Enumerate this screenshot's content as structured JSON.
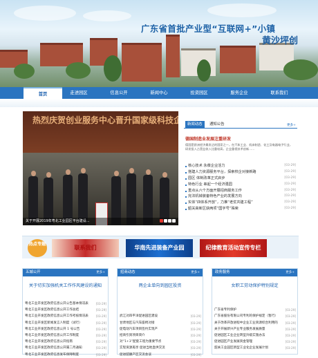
{
  "banner": {
    "title": "广东省首批产业型“互联网+”小镇",
    "subtitle": "黄沙坪创"
  },
  "nav": [
    "首页",
    "走进园区",
    "信息公开",
    "新闻中心",
    "投资园区",
    "服务企业",
    "联系我们"
  ],
  "slideshow": {
    "caption": "关于开展2019年粤北工业园区平台建设...",
    "banner_text": "热烈庆贺创业服务中心晋升国家级科技企业孵化器"
  },
  "news": {
    "tabs": [
      "新闻动态",
      "通知公告"
    ],
    "more": "更多+",
    "headline": "德国制造业发展注重研发",
    "summary": "德国是欧洲经济最发达的国家之一，在汽车工业、机床制造、化工及电器电子行业，研发投入占营业收入比重较高，企业重视技术创新......",
    "items": [
      {
        "t": "核心技术 永葆企业活力",
        "d": "[03-29]"
      },
      {
        "t": "搭建人力资源服务平台，探索校企对接新路",
        "d": "[03-29]"
      },
      {
        "t": "园区 体制改革正式启步",
        "d": "[03-29]"
      },
      {
        "t": "特色行业 串起一个经济强园",
        "d": "[03-29]"
      },
      {
        "t": "重点从六个方面开展招商服务工作",
        "d": "[03-29]"
      },
      {
        "t": "完法机械装备特色产业的发展方向",
        "d": "[03-29]"
      },
      {
        "t": "实体“四体系开放”，力推“老优共建工程”",
        "d": "[03-29]"
      },
      {
        "t": "韶关高新区获两项“国字号”殊荣",
        "d": "[03-29]"
      }
    ]
  },
  "hot": {
    "label": "热点专题",
    "items": [
      "联系我们",
      "华南先进装备产业园",
      "纪律教育活动宣传专栏"
    ]
  },
  "cols": [
    {
      "title": "五城公开",
      "more": "更多+",
      "headline": "关于切实加强机关工作作风建设的通知",
      "rows": [
        {
          "t": "粤北工业开发区政府信息公开公告基本情况表",
          "d": "[03-29]"
        },
        {
          "t": "粤北工业开发区政府信息公开工作总结",
          "d": "[03-29]"
        },
        {
          "t": "粤北工业开发区政府信息公开工作考核情况表",
          "d": "[03-29]"
        },
        {
          "t": "粤北工业开发区新闻发言人制度（试行）",
          "d": "[03-29]"
        },
        {
          "t": "粤北工业开发区政府信息公开 1 号公告",
          "d": "[03-29]"
        },
        {
          "t": "粤北工业开发区政府信息公开工作制度",
          "d": "[03-29]"
        },
        {
          "t": "粤北工业开发区政府信息公开指南",
          "d": "[03-29]"
        },
        {
          "t": "粤北工业开发区政府信息公开属二月通知",
          "d": "[03-29]"
        },
        {
          "t": "粤北工业开发区政府信息发布保障制度",
          "d": "[03-29]"
        }
      ]
    },
    {
      "title": "招商动态",
      "more": "更多+",
      "headline": "两企业单向到园区投资",
      "rows": [
        {
          "t": "",
          "d": ""
        },
        {
          "t": "",
          "d": ""
        },
        {
          "t": "武江对四平洋促进园区建设",
          "d": "[03-29]"
        },
        {
          "t": "甘肃地区与汽车座椅对接",
          "d": "[03-29]"
        },
        {
          "t": "促电动汽车项目签约实现产",
          "d": "[03-29]"
        },
        {
          "t": "招商引资项目简介",
          "d": "[03-29]"
        },
        {
          "t": "对“1+3”配套工程为重要节点",
          "d": "[03-29]"
        },
        {
          "t": "实现资源再享 促进当地直供交流",
          "d": "[03-29]"
        },
        {
          "t": "促进韶康产区交流会谈",
          "d": "[03-29]"
        }
      ]
    },
    {
      "title": "政务服务",
      "more": "更多+",
      "headline": "女职工劳动保护特别规定",
      "rows": [
        {
          "t": "",
          "d": ""
        },
        {
          "t": "广东省专利保护",
          "d": "[03-29]"
        },
        {
          "t": "广东省股份有限公司专利的保护规定（暂行）",
          "d": "[03-29]"
        },
        {
          "t": "关于改革开放进程中企业工业资源综合利用的通知",
          "d": "[03-29]"
        },
        {
          "t": "关于开展新兴产业专业服务发展质量",
          "d": "[03-29]"
        },
        {
          "t": "促进园区工业企业转型升级实施办法",
          "d": "[03-29]"
        },
        {
          "t": "促进园区产业发展资金管理",
          "d": "[03-29]"
        },
        {
          "t": "韶关工业园区新型工业化企业发展计划",
          "d": "[03-29]"
        },
        {
          "t": "",
          "d": ""
        }
      ]
    }
  ]
}
